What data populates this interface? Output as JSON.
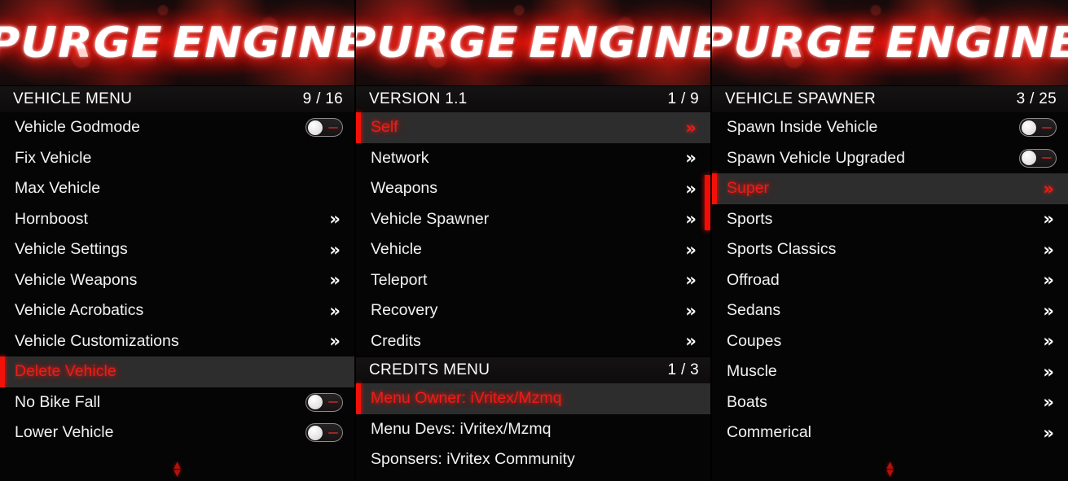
{
  "banner": {
    "word1": "PURGE",
    "word2": "ENGINE"
  },
  "icons": {
    "chevron_right_double": "»",
    "scroll_up": "▴",
    "scroll_down": "▾"
  },
  "columns": [
    {
      "menus": [
        {
          "title": "VEHICLE MENU",
          "count": "9 / 16",
          "items": [
            {
              "label": "Vehicle Godmode",
              "type": "toggle",
              "value": "off",
              "selected": false
            },
            {
              "label": "Fix Vehicle",
              "type": "action",
              "selected": false
            },
            {
              "label": "Max Vehicle",
              "type": "action",
              "selected": false
            },
            {
              "label": "Hornboost",
              "type": "submenu",
              "selected": false
            },
            {
              "label": "Vehicle Settings",
              "type": "submenu",
              "selected": false
            },
            {
              "label": "Vehicle Weapons",
              "type": "submenu",
              "selected": false
            },
            {
              "label": "Vehicle Acrobatics",
              "type": "submenu",
              "selected": false
            },
            {
              "label": "Vehicle Customizations",
              "type": "submenu",
              "selected": false
            },
            {
              "label": "Delete Vehicle",
              "type": "action",
              "selected": true
            },
            {
              "label": "No Bike Fall",
              "type": "toggle",
              "value": "off",
              "selected": false
            },
            {
              "label": "Lower Vehicle",
              "type": "toggle",
              "value": "off",
              "selected": false
            }
          ]
        }
      ]
    },
    {
      "menus": [
        {
          "title": "VERSION 1.1",
          "count": "1 / 9",
          "items": [
            {
              "label": "Self",
              "type": "submenu",
              "selected": true
            },
            {
              "label": "Network",
              "type": "submenu",
              "selected": false
            },
            {
              "label": "Weapons",
              "type": "submenu",
              "selected": false
            },
            {
              "label": "Vehicle Spawner",
              "type": "submenu",
              "selected": false
            },
            {
              "label": "Vehicle",
              "type": "submenu",
              "selected": false
            },
            {
              "label": "Teleport",
              "type": "submenu",
              "selected": false
            },
            {
              "label": "Recovery",
              "type": "submenu",
              "selected": false
            },
            {
              "label": "Credits",
              "type": "submenu",
              "selected": false
            }
          ]
        },
        {
          "title": "CREDITS MENU",
          "count": "1 / 3",
          "items": [
            {
              "label": "Menu Owner: iVritex/Mzmq",
              "type": "action",
              "selected": true
            },
            {
              "label": "Menu Devs: iVritex/Mzmq",
              "type": "action",
              "selected": false
            },
            {
              "label": "Sponsers: iVritex Community",
              "type": "action",
              "selected": false
            }
          ]
        }
      ]
    },
    {
      "menus": [
        {
          "title": "VEHICLE SPAWNER",
          "count": "3 / 25",
          "items": [
            {
              "label": "Spawn Inside Vehicle",
              "type": "toggle",
              "value": "off",
              "selected": false
            },
            {
              "label": "Spawn Vehicle Upgraded",
              "type": "toggle",
              "value": "off",
              "selected": false
            },
            {
              "label": "Super",
              "type": "submenu",
              "selected": true
            },
            {
              "label": "Sports",
              "type": "submenu",
              "selected": false
            },
            {
              "label": "Sports Classics",
              "type": "submenu",
              "selected": false
            },
            {
              "label": "Offroad",
              "type": "submenu",
              "selected": false
            },
            {
              "label": "Sedans",
              "type": "submenu",
              "selected": false
            },
            {
              "label": "Coupes",
              "type": "submenu",
              "selected": false
            },
            {
              "label": "Muscle",
              "type": "submenu",
              "selected": false
            },
            {
              "label": "Boats",
              "type": "submenu",
              "selected": false
            },
            {
              "label": "Commerical",
              "type": "submenu",
              "selected": false
            }
          ]
        }
      ]
    }
  ],
  "colors": {
    "accent_red": "#f21108",
    "selected_bg": "#2e2d2d",
    "menu_bg": "#050505",
    "text": "#f2f2f2"
  }
}
